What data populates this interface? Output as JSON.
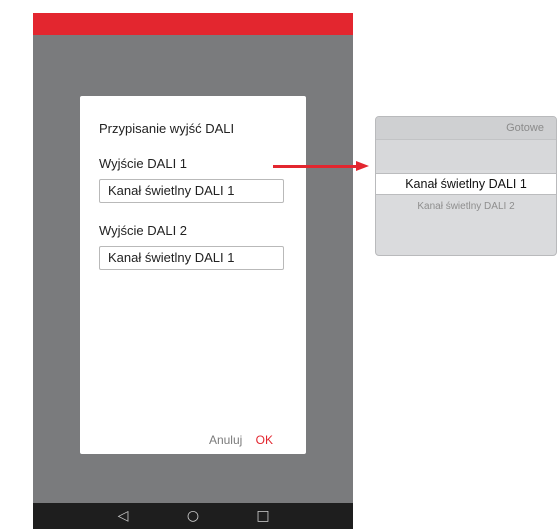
{
  "dialog": {
    "title": "Przypisanie wyjść DALI",
    "output1": {
      "label": "Wyjście DALI 1",
      "value": "Kanał świetlny DALI 1"
    },
    "output2": {
      "label": "Wyjście DALI 2",
      "value": "Kanał świetlny DALI 1"
    },
    "cancel_label": "Anuluj",
    "ok_label": "OK"
  },
  "navbar": {
    "back": "◁",
    "home": "○",
    "recents": "□"
  },
  "picker": {
    "done_label": "Gotowe",
    "selected": "Kanał świetlny DALI 1",
    "options": [
      "Kanał świetlny DALI 2"
    ]
  },
  "colors": {
    "accent": "#e3262f",
    "overlay": "#7a7b7d",
    "navbar": "#1e1e1e"
  }
}
